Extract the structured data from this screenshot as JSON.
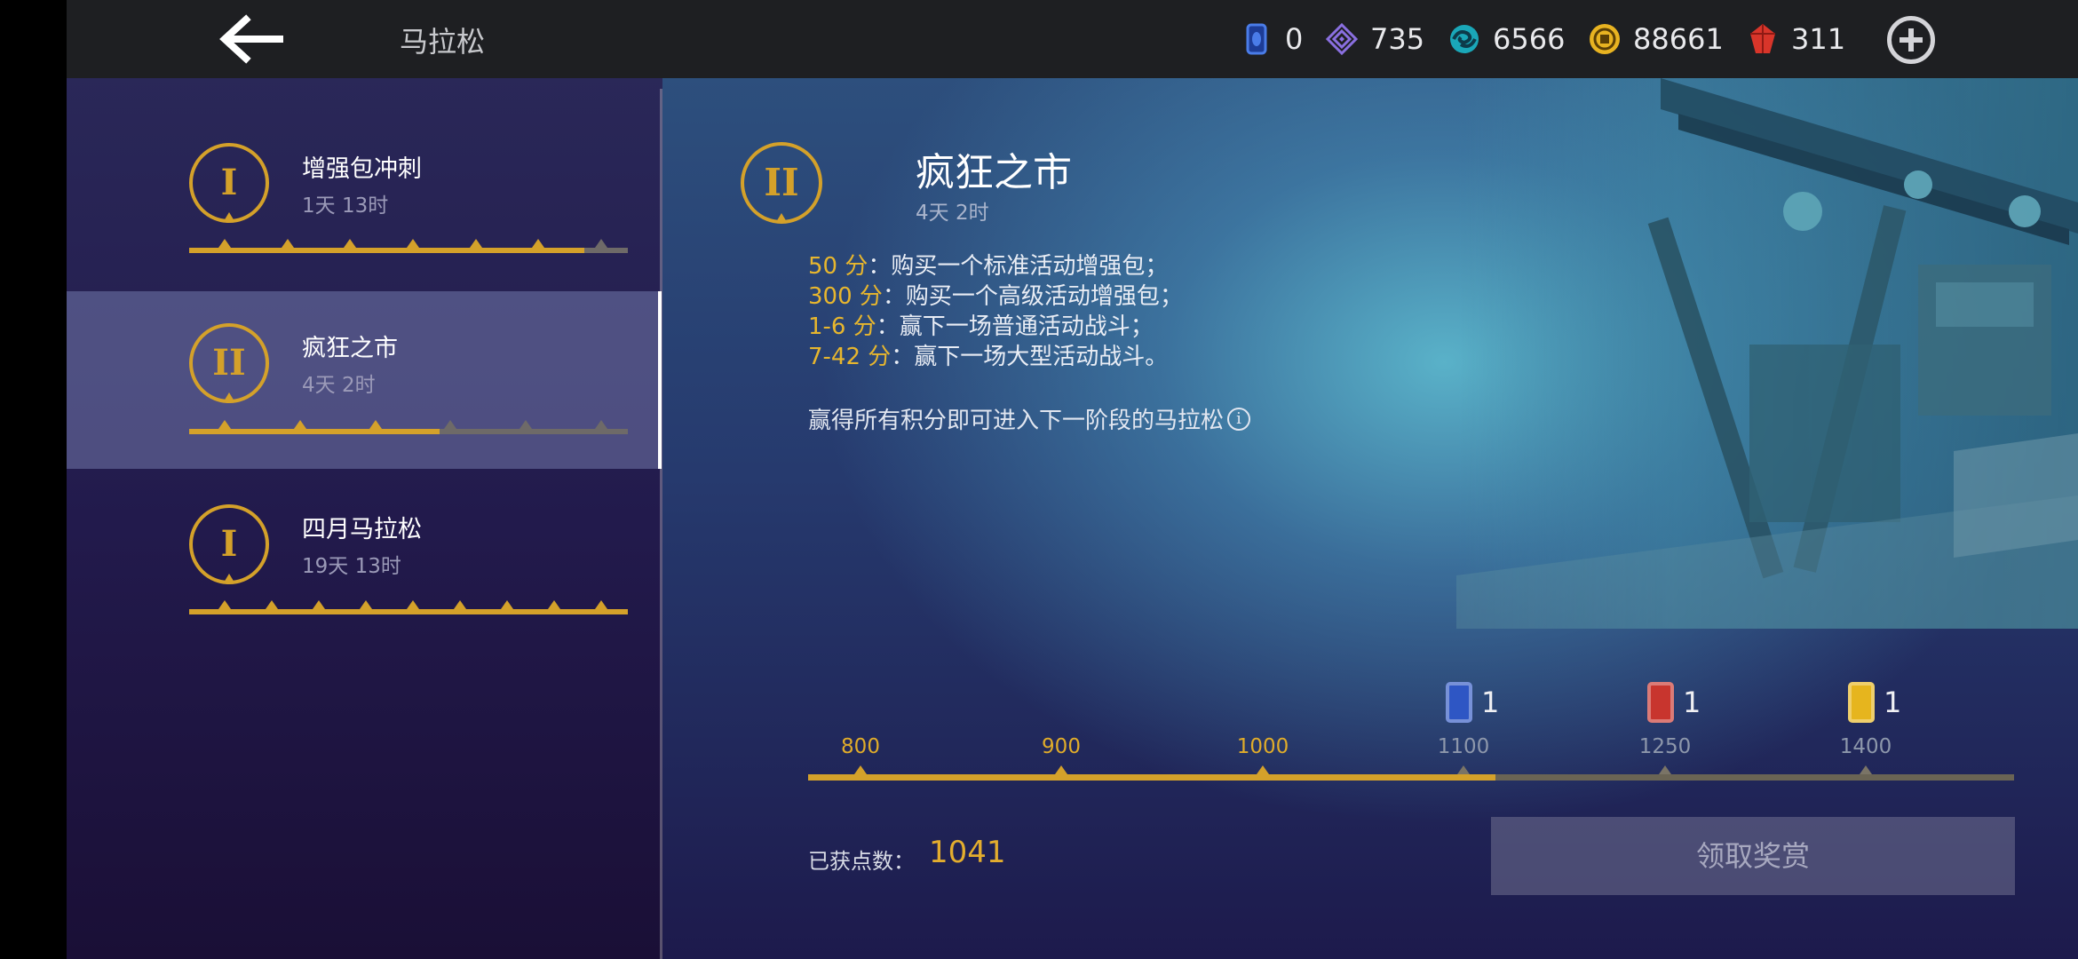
{
  "header": {
    "title": "马拉松",
    "back_icon": "back-arrow-icon",
    "currencies": [
      {
        "name": "blue-card-icon",
        "color": "#3a6fd8",
        "value": "0"
      },
      {
        "name": "purple-diamond-icon",
        "color": "#8a6fe0",
        "value": "735"
      },
      {
        "name": "teal-swirl-icon",
        "color": "#1aa7b8",
        "value": "6566"
      },
      {
        "name": "gold-coin-icon",
        "color": "#e8b321",
        "value": "88661"
      },
      {
        "name": "red-gem-icon",
        "color": "#d8352a",
        "value": "311"
      }
    ],
    "add_icon": "plus-circle-icon"
  },
  "sidebar": {
    "items": [
      {
        "stage": "I",
        "name": "增强包冲刺",
        "time": "1天 13时",
        "progress": 0.9,
        "milestones": 7,
        "reached": 6,
        "active": false
      },
      {
        "stage": "II",
        "name": "疯狂之市",
        "time": "4天 2时",
        "progress": 0.57,
        "milestones": 6,
        "reached": 3,
        "active": true
      },
      {
        "stage": "I",
        "name": "四月马拉松",
        "time": "19天 13时",
        "progress": 1.0,
        "milestones": 9,
        "reached": 9,
        "active": false
      }
    ]
  },
  "main": {
    "stage": "II",
    "title": "疯狂之市",
    "time": "4天 2时",
    "rules": [
      {
        "points": "50 分",
        "text": "：购买一个标准活动增强包；"
      },
      {
        "points": "300 分",
        "text": "：购买一个高级活动增强包；"
      },
      {
        "points": "1-6 分",
        "text": "：赢下一场普通活动战斗；"
      },
      {
        "points": "7-42 分",
        "text": "：赢下一场大型活动战斗。"
      }
    ],
    "note": "赢得所有积分即可进入下一阶段的马拉松",
    "info_icon": "info-icon",
    "milestones": [
      {
        "value": 800,
        "reached": true
      },
      {
        "value": 900,
        "reached": true
      },
      {
        "value": 1000,
        "reached": true
      },
      {
        "value": 1100,
        "reached": false,
        "reward": {
          "icon": "blue-card-icon",
          "color": "#2e56c4",
          "count": "1"
        }
      },
      {
        "value": 1250,
        "reached": false,
        "reward": {
          "icon": "red-card-icon",
          "color": "#c8352e",
          "count": "1"
        }
      },
      {
        "value": 1400,
        "reached": false,
        "reward": {
          "icon": "gold-card-icon",
          "color": "#e6b51e",
          "count": "1"
        }
      }
    ],
    "track_progress": 0.57,
    "points_label": "已获点数：",
    "points_value": "1041",
    "claim_button": "领取奖赏"
  }
}
